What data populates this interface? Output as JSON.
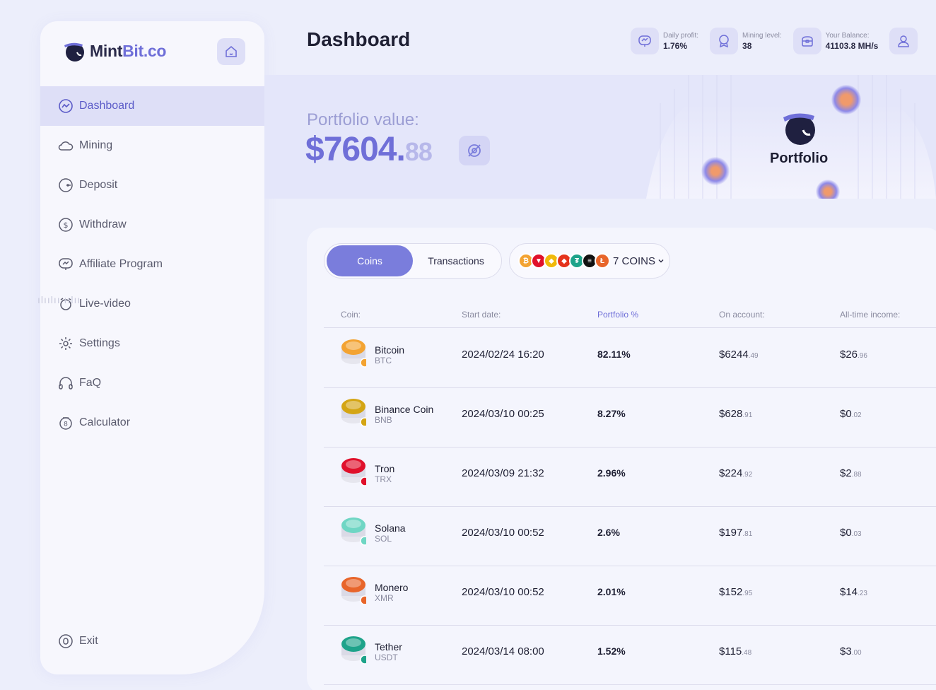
{
  "brand": {
    "part1": "Mint",
    "part2": "Bit.co"
  },
  "nav": {
    "items": [
      {
        "label": "Dashboard",
        "icon": "chart-circle-icon",
        "active": true
      },
      {
        "label": "Mining",
        "icon": "cloud-icon"
      },
      {
        "label": "Deposit",
        "icon": "wallet-icon"
      },
      {
        "label": "Withdraw",
        "icon": "dollar-circle-icon"
      },
      {
        "label": "Affiliate Program",
        "icon": "monitor-icon"
      },
      {
        "label": "Live-video",
        "icon": "alarm-icon"
      },
      {
        "label": "Settings",
        "icon": "gear-icon"
      },
      {
        "label": "FaQ",
        "icon": "headphones-icon"
      },
      {
        "label": "Calculator",
        "icon": "calculator-icon"
      }
    ],
    "exit": "Exit"
  },
  "header": {
    "title": "Dashboard",
    "stats": [
      {
        "label": "Daily profit:",
        "value": "1.76%"
      },
      {
        "label": "Mining level:",
        "value": "38"
      },
      {
        "label": "Your Balance:",
        "value": "41103.8 MH/s"
      }
    ]
  },
  "portfolio": {
    "label": "Portfolio value:",
    "value_main": "$7604.",
    "value_cents": "88",
    "brand_label": "Portfolio"
  },
  "tabs": {
    "coins": "Coins",
    "transactions": "Transactions"
  },
  "coin_selector": {
    "label": "7 COINS"
  },
  "table": {
    "headers": [
      "Coin:",
      "Start date:",
      "Portfolio %",
      "On account:",
      "All-time income:"
    ],
    "rows": [
      {
        "name": "Bitcoin",
        "symbol": "BTC",
        "date": "2024/02/24 16:20",
        "pct": "82.11%",
        "acct_main": "$6244",
        "acct_cents": ".49",
        "inc_main": "$26",
        "inc_cents": ".96",
        "color": "#f3a332"
      },
      {
        "name": "Binance Coin",
        "symbol": "BNB",
        "date": "2024/03/10 00:25",
        "pct": "8.27%",
        "acct_main": "$628",
        "acct_cents": ".91",
        "inc_main": "$0",
        "inc_cents": ".02",
        "color": "#d4a514"
      },
      {
        "name": "Tron",
        "symbol": "TRX",
        "date": "2024/03/09 21:32",
        "pct": "2.96%",
        "acct_main": "$224",
        "acct_cents": ".92",
        "inc_main": "$2",
        "inc_cents": ".88",
        "color": "#e0102b"
      },
      {
        "name": "Solana",
        "symbol": "SOL",
        "date": "2024/03/10 00:52",
        "pct": "2.6%",
        "acct_main": "$197",
        "acct_cents": ".81",
        "inc_main": "$0",
        "inc_cents": ".03",
        "color": "#6fd6c4"
      },
      {
        "name": "Monero",
        "symbol": "XMR",
        "date": "2024/03/10 00:52",
        "pct": "2.01%",
        "acct_main": "$152",
        "acct_cents": ".95",
        "inc_main": "$14",
        "inc_cents": ".23",
        "color": "#e8652a"
      },
      {
        "name": "Tether",
        "symbol": "USDT",
        "date": "2024/03/14 08:00",
        "pct": "1.52%",
        "acct_main": "$115",
        "acct_cents": ".48",
        "inc_main": "$3",
        "inc_cents": ".00",
        "color": "#1ea38a"
      }
    ]
  }
}
